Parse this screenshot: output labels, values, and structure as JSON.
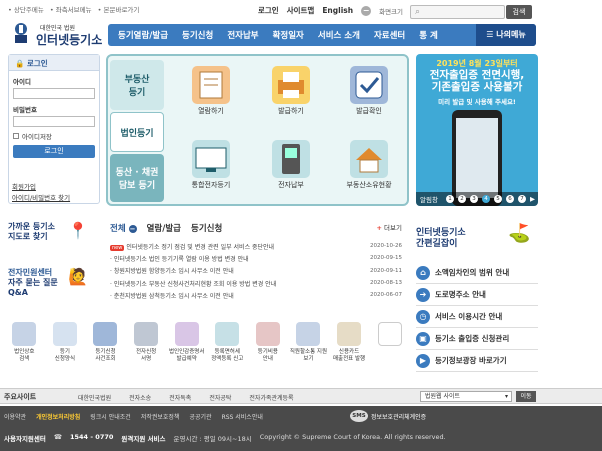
{
  "top": {
    "skip_links": [
      "상단주메뉴",
      "좌측서브메뉴",
      "본문바로가기"
    ],
    "login": "로그인",
    "sitemap": "사이트맵",
    "english": "English",
    "zoom_label": "화면크기",
    "search_button": "검색"
  },
  "logo": {
    "sub": "대한민국 법원",
    "main": "인터넷등기소"
  },
  "nav": {
    "items": [
      "등기열람/발급",
      "등기신청",
      "전자납부",
      "확정일자",
      "서비스 소개",
      "자료센터",
      "통 계"
    ],
    "my_menu": "나의메뉴"
  },
  "login": {
    "title": "로그인",
    "id_label": "아이디",
    "pw_label": "비밀번호",
    "save_id": "아이디저장",
    "button": "로그인",
    "signup": "회원가입",
    "find": "아이디/비밀번호 찾기"
  },
  "quick": {
    "categories": [
      "부동산\n등기",
      "법인등기",
      "동산 · 채권\n담보 등기"
    ],
    "tiles": [
      "열람하기",
      "발급하기",
      "발급확인",
      "통합전자등기",
      "전자납부",
      "부동산소유현황"
    ]
  },
  "banner": {
    "line1": "2019년 8월 23일부터",
    "line2a": "전자출입증 전면시행,",
    "line2b": "기존출입증 사용불가",
    "line3": "미리 발급 및 사용해 주세요!",
    "pager_label": "알림창",
    "pages": [
      "1",
      "2",
      "3",
      "4",
      "5",
      "6",
      "7"
    ],
    "active_page": "4"
  },
  "promo": {
    "line1": "가까운 등기소",
    "line2": "지도로 찾기",
    "center_title": "전자민원센터",
    "center_sub1": "자주 묻는 질문",
    "center_sub2": "Q&A"
  },
  "notice": {
    "tabs": [
      "전체",
      "열람/발급",
      "등기신청"
    ],
    "more": "더보기",
    "items": [
      {
        "new": true,
        "title": "인터넷등기소 정기 점검 및 변경 관련 일부 서비스 중단안내",
        "date": "2020-10-26"
      },
      {
        "new": false,
        "title": "인터넷등기소 법인 등기기록 열람 이용 방법 변경 안내",
        "date": "2020-09-15"
      },
      {
        "new": false,
        "title": "창원지방법원 함양등기소 임시 사무소 이전 안내",
        "date": "2020-09-11"
      },
      {
        "new": false,
        "title": "인터넷등기소 부동산 신청사건처리현황 조회 이용 방법 변경 안내",
        "date": "2020-08-13"
      },
      {
        "new": false,
        "title": "춘천지방법원 삼척등기소 임시 사무소 이전 안내",
        "date": "2020-06-07"
      }
    ]
  },
  "rightlinks": {
    "title1": "인터넷등기소",
    "title2": "간편길잡이",
    "items": [
      "소액임차인의 범위 안내",
      "도로명주소 안내",
      "서비스 이용시간 안내",
      "등기소 출입증 신청관리",
      "등기정보광장 바로가기"
    ]
  },
  "iconrow": [
    [
      "법인상호",
      "검색"
    ],
    [
      "등기",
      "신청양식"
    ],
    [
      "등기신청",
      "사건조회"
    ],
    [
      "전자신청",
      "서명"
    ],
    [
      "법인인감증명서",
      "발급예약"
    ],
    [
      "등록면허세",
      "정액등록 신고"
    ],
    [
      "등기비용",
      "안내"
    ],
    [
      "직원할소통 지원",
      "보기"
    ],
    [
      "신용카드",
      "매출전표 발행"
    ],
    []
  ],
  "familybar": {
    "title": "주요사이트",
    "links": [
      "대한민국법원",
      "전자소송",
      "전자독촉",
      "전자공탁",
      "전자가족관계등록"
    ],
    "select": "법원웹 사이트",
    "go": "이동"
  },
  "footer": {
    "links": [
      "이용약관",
      "개인정보처리방침",
      "링크시 안내조건",
      "저작권보호정책",
      "공공기관",
      "RSS 서비스안내"
    ],
    "sms_badge": "SMS",
    "sms_text": "정보보호관리체계인증",
    "center": "사용자지원센터",
    "phone": "1544 - 0770",
    "site": "원격지원 서비스",
    "hours": "운영시간 : 평일 09시~18시",
    "copyright": "Copyright © Supreme Court of Korea. All rights reserved."
  },
  "colors": {
    "brand": "#3b7bbf",
    "brand_dark": "#1e4d8c",
    "panel": "#8fc3c9",
    "banner": "#3fa9d6"
  }
}
